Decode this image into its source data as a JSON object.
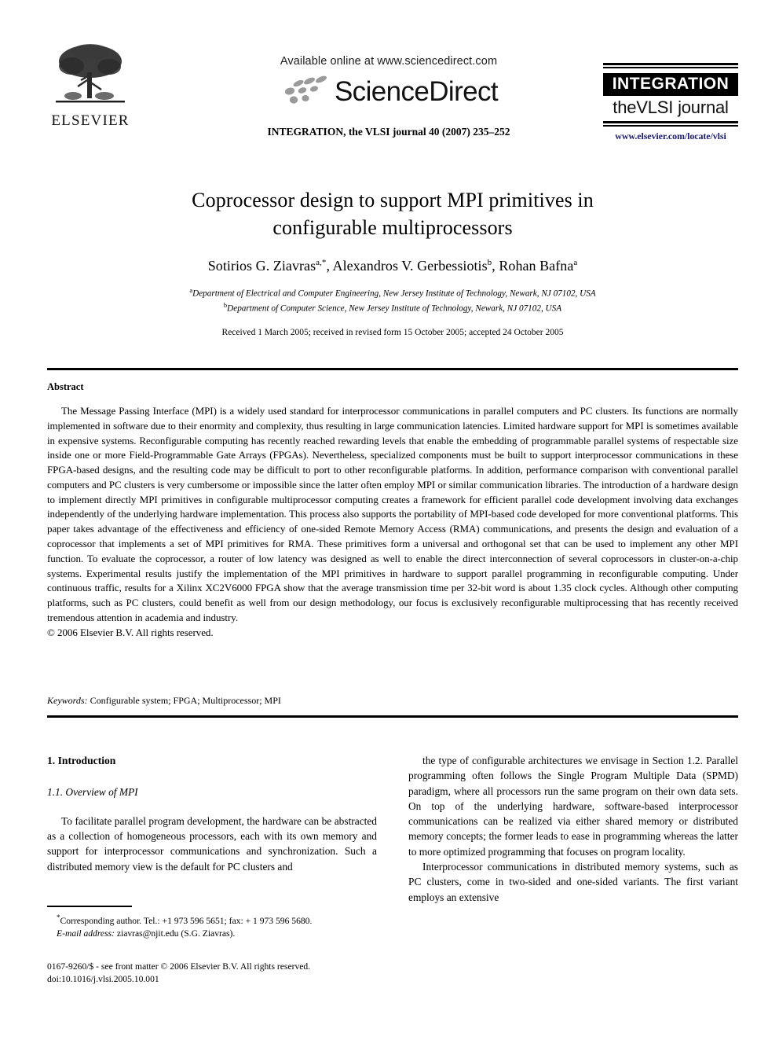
{
  "masthead": {
    "publisher_name": "ELSEVIER",
    "available_online": "Available online at www.sciencedirect.com",
    "sciencedirect_wordmark": "ScienceDirect",
    "journal_citation": "INTEGRATION, the VLSI journal 40 (2007) 235–252",
    "journal_logo_title": "INTEGRATION",
    "journal_logo_subtitle": "theVLSI journal",
    "journal_url": "www.elsevier.com/locate/vlsi",
    "url_color": "#1a1a6e"
  },
  "title_block": {
    "title_line1": "Coprocessor design to support MPI primitives in",
    "title_line2": "configurable multiprocessors",
    "authors": "Sotirios G. Ziavras",
    "author1_sup": "a,*",
    "author2_prefix": ", Alexandros V. Gerbessiotis",
    "author2_sup": "b",
    "author3_prefix": ", Rohan Bafna",
    "author3_sup": "a",
    "affiliation_a_sup": "a",
    "affiliation_a": "Department of Electrical and Computer Engineering, New Jersey Institute of Technology, Newark, NJ 07102, USA",
    "affiliation_b_sup": "b",
    "affiliation_b": "Department of Computer Science, New Jersey Institute of Technology, Newark, NJ 07102, USA",
    "dates": "Received 1 March 2005; received in revised form 15 October 2005; accepted 24 October 2005"
  },
  "abstract": {
    "heading": "Abstract",
    "body": "The Message Passing Interface (MPI) is a widely used standard for interprocessor communications in parallel computers and PC clusters. Its functions are normally implemented in software due to their enormity and complexity, thus resulting in large communication latencies. Limited hardware support for MPI is sometimes available in expensive systems. Reconfigurable computing has recently reached rewarding levels that enable the embedding of programmable parallel systems of respectable size inside one or more Field-Programmable Gate Arrays (FPGAs). Nevertheless, specialized components must be built to support interprocessor communications in these FPGA-based designs, and the resulting code may be difficult to port to other reconfigurable platforms. In addition, performance comparison with conventional parallel computers and PC clusters is very cumbersome or impossible since the latter often employ MPI or similar communication libraries. The introduction of a hardware design to implement directly MPI primitives in configurable multiprocessor computing creates a framework for efficient parallel code development involving data exchanges independently of the underlying hardware implementation. This process also supports the portability of MPI-based code developed for more conventional platforms. This paper takes advantage of the effectiveness and efficiency of one-sided Remote Memory Access (RMA) communications, and presents the design and evaluation of a coprocessor that implements a set of MPI primitives for RMA. These primitives form a universal and orthogonal set that can be used to implement any other MPI function. To evaluate the coprocessor, a router of low latency was designed as well to enable the direct interconnection of several coprocessors in cluster-on-a-chip systems. Experimental results justify the implementation of the MPI primitives in hardware to support parallel programming in reconfigurable computing. Under continuous traffic, results for a Xilinx XC2V6000 FPGA show that the average transmission time per 32-bit word is about 1.35 clock cycles. Although other computing platforms, such as PC clusters, could benefit as well from our design methodology, our focus is exclusively reconfigurable multiprocessing that has recently received tremendous attention in academia and industry.",
    "copyright": "© 2006 Elsevier B.V. All rights reserved."
  },
  "keywords": {
    "label": "Keywords:",
    "value": " Configurable system; FPGA; Multiprocessor; MPI"
  },
  "body": {
    "section_heading": "1.  Introduction",
    "subsection_heading": "1.1.  Overview of MPI",
    "left_paragraph_1": "To facilitate parallel program development, the hardware can be abstracted as a collection of homogeneous processors, each with its own memory and support for interprocessor communications and synchronization. Such a distributed memory view is the default for PC clusters and",
    "right_paragraph_1": "the type of configurable architectures we envisage in Section 1.2. Parallel programming often follows the Single Program Multiple Data (SPMD) paradigm, where all processors run the same program on their own data sets. On top of the underlying hardware, software-based interprocessor communications can be realized via either shared memory or distributed memory concepts; the former leads to ease in programming whereas the latter to more optimized programming that focuses on program locality.",
    "right_paragraph_2": "Interprocessor communications in distributed memory systems, such as PC clusters, come in two-sided and one-sided variants. The first variant employs an extensive"
  },
  "footnote": {
    "marker": "*",
    "corresponding": "Corresponding author. Tel.: +1 973 596 5651; fax: + 1 973 596 5680.",
    "email_label": "E-mail address:",
    "email_value": " ziavras@njit.edu (S.G. Ziavras)."
  },
  "footer": {
    "issn_line": "0167-9260/$ - see front matter © 2006 Elsevier B.V. All rights reserved.",
    "doi_line": "doi:10.1016/j.vlsi.2005.10.001"
  }
}
